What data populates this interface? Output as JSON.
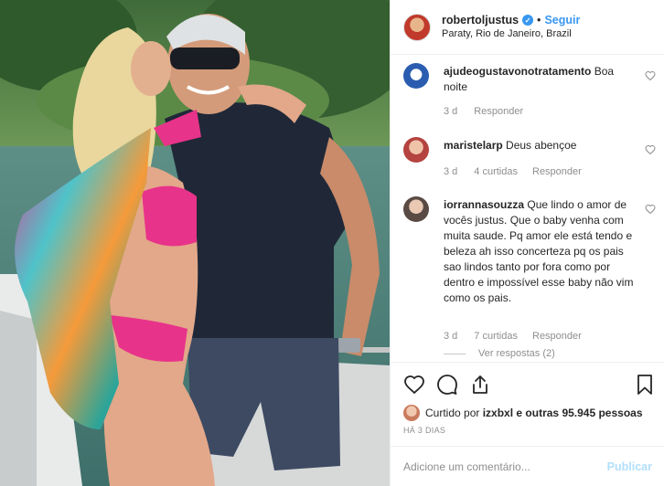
{
  "header": {
    "username": "robertoljustus",
    "verified_icon": "verified-badge-icon",
    "separator": "•",
    "follow_label": "Seguir",
    "location": "Paraty, Rio de Janeiro, Brazil"
  },
  "comments": [
    {
      "user": "ajudeogustavonotratamento",
      "text": "Boa noite",
      "time": "3 d",
      "reply_label": "Responder"
    },
    {
      "user": "maristelarp",
      "text": "Deus abençoe",
      "time": "3 d",
      "likes": "4 curtidas",
      "reply_label": "Responder"
    },
    {
      "user": "iorrannasouzza",
      "text": "Que lindo o amor de vocês justus. Que o baby venha com muita saude. Pq amor ele está tendo e beleza ah isso concerteza pq os pais sao lindos tanto por fora como por dentro e impossível esse baby não vim como os pais.",
      "time": "3 d",
      "likes": "7 curtidas",
      "reply_label": "Responder",
      "view_replies": "Ver respostas (2)"
    }
  ],
  "actions": {
    "like_icon": "heart-icon",
    "comment_icon": "comment-icon",
    "share_icon": "share-icon",
    "save_icon": "bookmark-icon"
  },
  "likes_summary": {
    "prefix": "Curtido por",
    "user": "izxbxl",
    "suffix": "e outras 95.945 pessoas"
  },
  "date": "HÁ 3 DIAS",
  "add_comment": {
    "placeholder": "Adicione um comentário...",
    "publish_label": "Publicar"
  },
  "colors": {
    "accent": "#3897f0",
    "muted": "#8e8e8e",
    "publish_disabled": "#b2dffc"
  }
}
